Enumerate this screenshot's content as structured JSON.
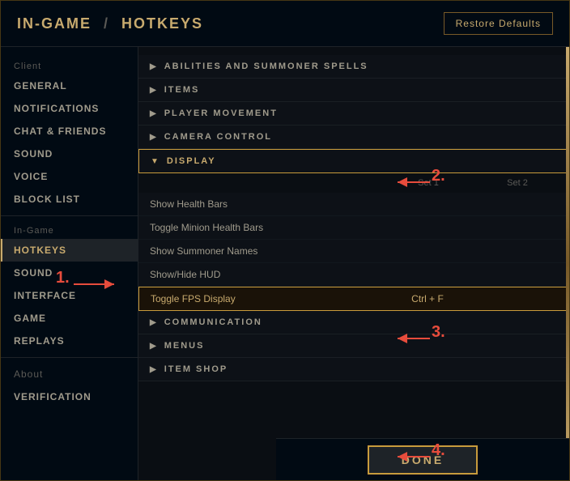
{
  "header": {
    "breadcrumb_part1": "IN-GAME",
    "breadcrumb_separator": "/",
    "breadcrumb_part2": "HOTKEYS",
    "restore_defaults_label": "Restore Defaults"
  },
  "sidebar": {
    "client_label": "Client",
    "in_game_label": "In-Game",
    "about_label": "About",
    "client_items": [
      {
        "id": "general",
        "label": "GENERAL",
        "active": false
      },
      {
        "id": "notifications",
        "label": "NOTIFICATIONS",
        "active": false
      },
      {
        "id": "chat-friends",
        "label": "CHAT & FRIENDS",
        "active": false
      },
      {
        "id": "sound",
        "label": "SOUND",
        "active": false
      },
      {
        "id": "voice",
        "label": "VOICE",
        "active": false
      },
      {
        "id": "block-list",
        "label": "BLOCK LIST",
        "active": false
      }
    ],
    "in_game_items": [
      {
        "id": "hotkeys",
        "label": "HOTKEYS",
        "active": true
      },
      {
        "id": "sound",
        "label": "SOUND",
        "active": false
      },
      {
        "id": "interface",
        "label": "INTERFACE",
        "active": false
      },
      {
        "id": "game",
        "label": "GAME",
        "active": false
      },
      {
        "id": "replays",
        "label": "REPLAYS",
        "active": false
      }
    ],
    "bottom_items": [
      {
        "id": "about",
        "label": "About",
        "active": false
      },
      {
        "id": "verification",
        "label": "VERIFICATION",
        "active": false
      }
    ]
  },
  "content": {
    "sections": [
      {
        "id": "abilities",
        "label": "ABILITIES AND SUMMONER SPELLS",
        "expanded": false
      },
      {
        "id": "items",
        "label": "ITEMS",
        "expanded": false
      },
      {
        "id": "player-movement",
        "label": "PLAYER MOVEMENT",
        "expanded": false
      },
      {
        "id": "camera-control",
        "label": "CAMERA CONTROL",
        "expanded": false
      },
      {
        "id": "display",
        "label": "DISPLAY",
        "expanded": true
      }
    ],
    "table_headers": {
      "name": "",
      "set1": "Set 1",
      "set2": "Set 2"
    },
    "display_rows": [
      {
        "id": "show-health-bars",
        "name": "Show Health Bars",
        "set1": "",
        "set2": "",
        "highlighted": false
      },
      {
        "id": "toggle-minion-health",
        "name": "Toggle Minion Health Bars",
        "set1": "",
        "set2": "",
        "highlighted": false
      },
      {
        "id": "show-summoner-names",
        "name": "Show Summoner Names",
        "set1": "",
        "set2": "",
        "highlighted": false
      },
      {
        "id": "show-hide-hud",
        "name": "Show/Hide HUD",
        "set1": "",
        "set2": "",
        "highlighted": false
      },
      {
        "id": "toggle-fps",
        "name": "Toggle FPS Display",
        "set1": "Ctrl + F",
        "set2": "",
        "highlighted": true
      }
    ],
    "later_sections": [
      {
        "id": "communication",
        "label": "COMMUNICATION",
        "expanded": false
      },
      {
        "id": "menus",
        "label": "MENUS",
        "expanded": false
      },
      {
        "id": "item-shop",
        "label": "ITEM SHOP",
        "expanded": false
      }
    ]
  },
  "footer": {
    "done_label": "DONE"
  },
  "annotations": {
    "label_1": "1.",
    "label_2": "2.",
    "label_3": "3.",
    "label_4": "4."
  }
}
